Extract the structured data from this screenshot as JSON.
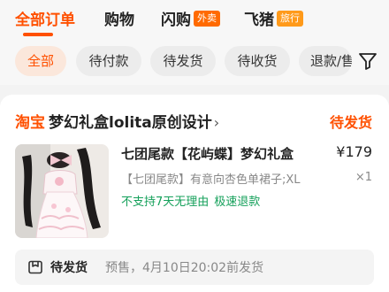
{
  "main_tabs": [
    {
      "label": "全部订单",
      "active": true
    },
    {
      "label": "购物",
      "active": false
    },
    {
      "label": "闪购",
      "badge": "外卖",
      "badge_color": "#ff6a00",
      "active": false
    },
    {
      "label": "飞猪",
      "badge": "旅行",
      "badge_color": "#ff9a1a",
      "active": false
    }
  ],
  "status_chips": [
    {
      "label": "全部",
      "active": true
    },
    {
      "label": "待付款",
      "active": false
    },
    {
      "label": "待发货",
      "active": false
    },
    {
      "label": "待收货",
      "active": false
    },
    {
      "label": "退款/售后",
      "active": false
    }
  ],
  "filter": {
    "icon": "filter-icon"
  },
  "order": {
    "platform": "淘宝",
    "shop_name": "梦幻礼盒lolita原创设计",
    "status": "待发货",
    "product": {
      "title": "七团尾款【花屿蝶】梦幻礼盒",
      "price": "¥179",
      "sku": "【七团尾款】有意向杏色单裙子;XL",
      "quantity": "×1",
      "service_tags": [
        "不支持7天无理由",
        "极速退款"
      ]
    },
    "shipping": {
      "status": "待发货",
      "note": "预售，4月10日20:02前发货"
    }
  },
  "colors": {
    "accent": "#ff5000",
    "service_green": "#14a05a",
    "chip_active_bg": "#fbe7db"
  }
}
